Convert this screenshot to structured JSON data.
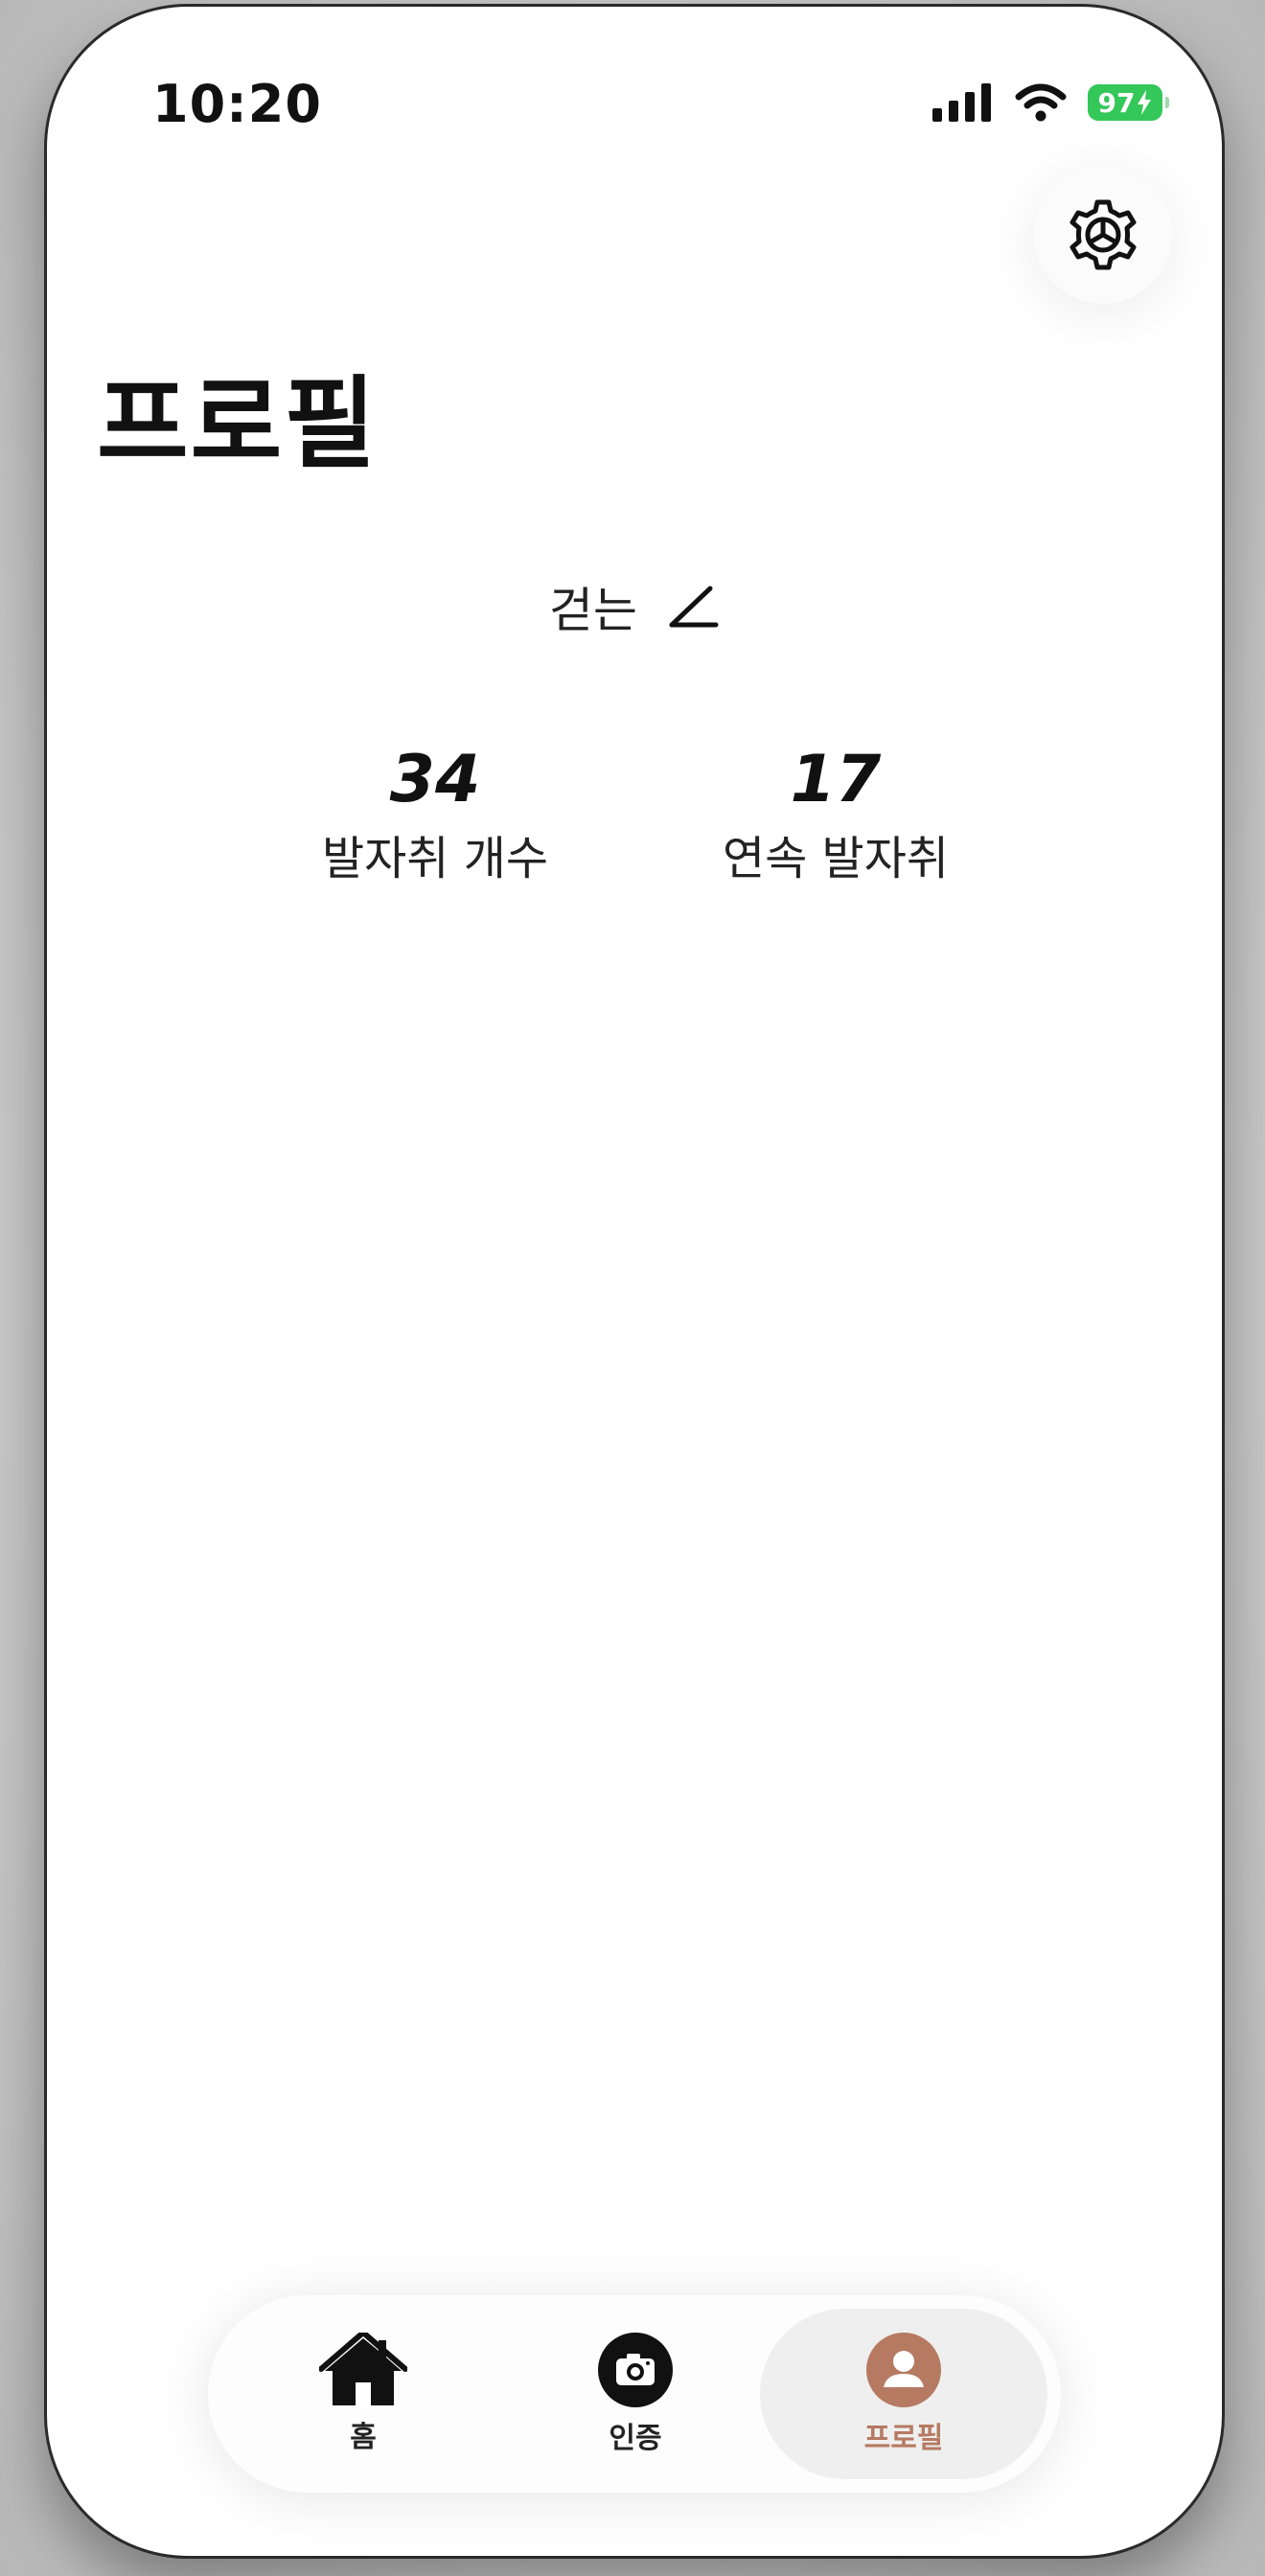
{
  "status_bar": {
    "time": "10:20",
    "battery": "97"
  },
  "header": {
    "title": "프로필",
    "settings_icon": "gear-icon"
  },
  "profile": {
    "nickname": "걷는",
    "edit_icon": "pencil-icon"
  },
  "stats": [
    {
      "value": "34",
      "label": "발자취 개수"
    },
    {
      "value": "17",
      "label": "연속 발자취"
    }
  ],
  "tabbar": {
    "tabs": [
      {
        "label": "홈",
        "icon": "home-icon",
        "active": false
      },
      {
        "label": "인증",
        "icon": "camera-icon",
        "active": false
      },
      {
        "label": "프로필",
        "icon": "person-icon",
        "active": true
      }
    ]
  },
  "colors": {
    "accent": "#b67a62",
    "battery": "#34c759",
    "active_tab_bg": "#efefef"
  }
}
